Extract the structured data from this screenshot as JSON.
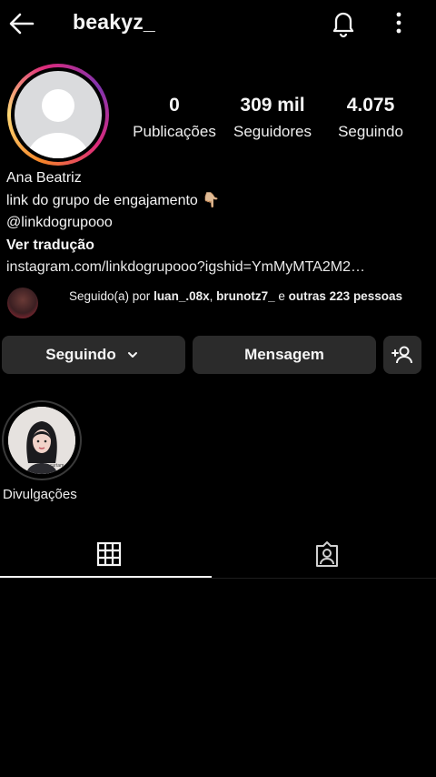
{
  "header": {
    "username": "beakyz_",
    "icons": {
      "back": "arrow-left-icon",
      "notifications": "bell-icon",
      "more": "more-vertical-icon"
    }
  },
  "profile": {
    "avatar_icon": "default-avatar-icon",
    "stats": [
      {
        "value": "0",
        "label": "Publicações"
      },
      {
        "value": "309 mil",
        "label": "Seguidores"
      },
      {
        "value": "4.075",
        "label": "Seguindo"
      }
    ],
    "name": "Ana Beatriz",
    "bio_line": "link do grupo de engajamento",
    "bio_emoji": "👇🏼",
    "mention": "@linkdogrupooo",
    "translate": "Ver tradução",
    "link": "instagram.com/linkdogrupooo?igshid=YmMyMTA2M2…"
  },
  "followed_by": {
    "prefix": "Seguido(a) por ",
    "user1": "luan_.08x",
    "sep": ", ",
    "user2": "brunotz7_",
    "middle": " e ",
    "rest": "outras 223 pessoas"
  },
  "actions": {
    "following_label": "Seguindo",
    "message_label": "Mensagem",
    "icons": {
      "chevron": "chevron-down-icon",
      "add_user": "add-user-icon"
    }
  },
  "highlights": [
    {
      "label": "Divulgações",
      "caption": "curtam"
    }
  ],
  "tabs": {
    "active": "grid",
    "icons": {
      "grid": "grid-icon",
      "tagged": "tagged-person-icon"
    }
  },
  "colors": {
    "background": "#000000",
    "button": "#2b2b2b",
    "text": "#f5f5f5",
    "ring_start": "#f58529",
    "ring_end": "#8134af"
  }
}
